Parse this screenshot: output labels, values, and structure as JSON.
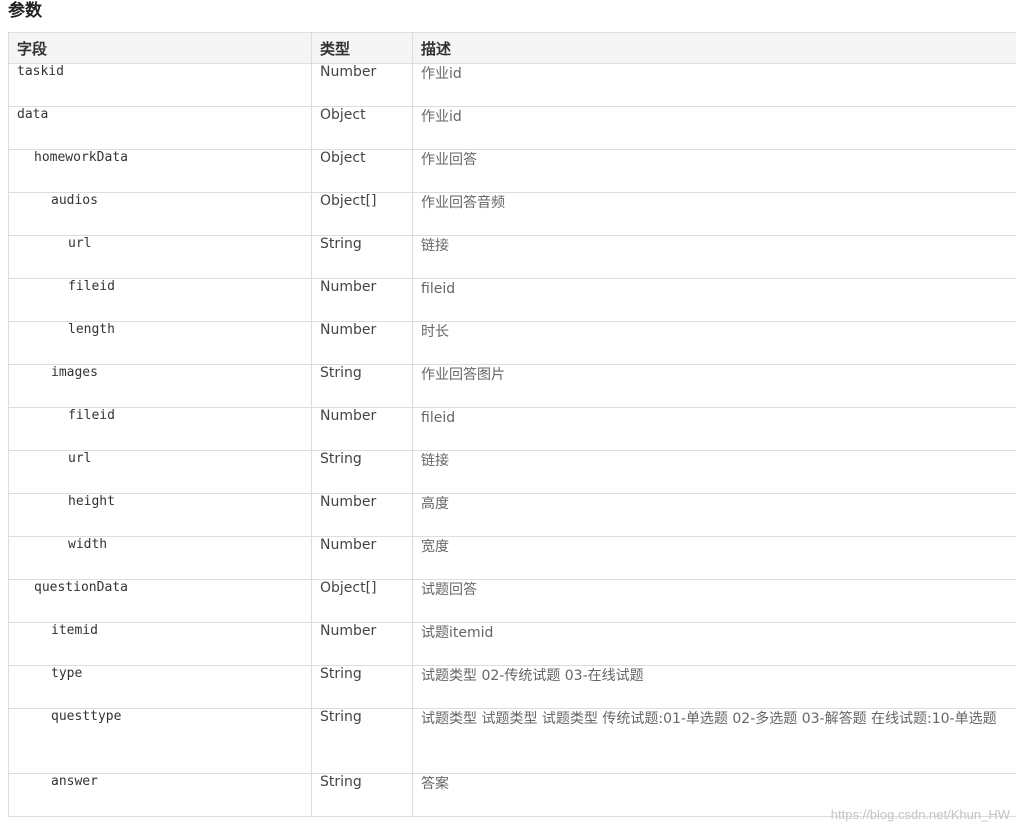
{
  "section_title": "参数",
  "columns": [
    "字段",
    "类型",
    "描述"
  ],
  "rows": [
    {
      "field": "taskid",
      "level": 0,
      "type": "Number",
      "desc": "作业id"
    },
    {
      "field": "data",
      "level": 0,
      "type": "Object",
      "desc": "作业id"
    },
    {
      "field": "homeworkData",
      "level": 1,
      "type": "Object",
      "desc": "作业回答"
    },
    {
      "field": "audios",
      "level": 2,
      "type": "Object[]",
      "desc": "作业回答音频"
    },
    {
      "field": "url",
      "level": 3,
      "type": "String",
      "desc": "链接"
    },
    {
      "field": "fileid",
      "level": 3,
      "type": "Number",
      "desc": "fileid"
    },
    {
      "field": "length",
      "level": 3,
      "type": "Number",
      "desc": "时长"
    },
    {
      "field": "images",
      "level": 2,
      "type": "String",
      "desc": "作业回答图片"
    },
    {
      "field": "fileid",
      "level": 3,
      "type": "Number",
      "desc": "fileid"
    },
    {
      "field": "url",
      "level": 3,
      "type": "String",
      "desc": "链接"
    },
    {
      "field": "height",
      "level": 3,
      "type": "Number",
      "desc": "高度"
    },
    {
      "field": "width",
      "level": 3,
      "type": "Number",
      "desc": "宽度"
    },
    {
      "field": "questionData",
      "level": 1,
      "type": "Object[]",
      "desc": "试题回答"
    },
    {
      "field": "itemid",
      "level": 2,
      "type": "Number",
      "desc": "试题itemid"
    },
    {
      "field": "type",
      "level": 2,
      "type": "String",
      "desc": "试题类型 02-传统试题 03-在线试题"
    },
    {
      "field": "questtype",
      "level": 2,
      "type": "String",
      "desc": "试题类型 试题类型 试题类型 传统试题:01-单选题 02-多选题 03-解答题 在线试题:10-单选题"
    },
    {
      "field": "answer",
      "level": 2,
      "type": "String",
      "desc": "答案"
    }
  ],
  "watermark": "https://blog.csdn.net/Khun_HW"
}
